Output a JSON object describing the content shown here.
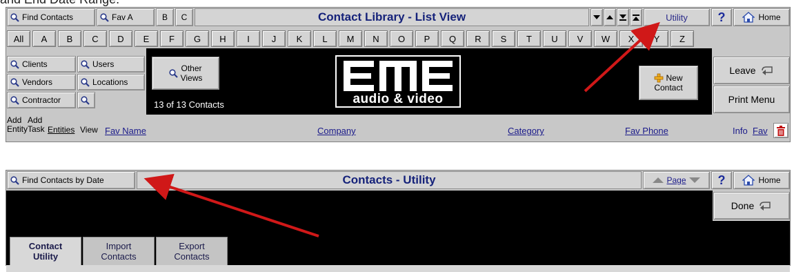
{
  "caption": "and End Date Range.",
  "list_view": {
    "title": "Contact Library - List View",
    "toolbar": {
      "find_contacts": "Find Contacts",
      "fav_a": "Fav A",
      "b": "B",
      "c": "C",
      "utility": "Utility",
      "help": "?",
      "home": "Home"
    },
    "letters": [
      "All",
      "A",
      "B",
      "C",
      "D",
      "E",
      "F",
      "G",
      "H",
      "I",
      "J",
      "K",
      "L",
      "M",
      "N",
      "O",
      "P",
      "Q",
      "R",
      "S",
      "T",
      "U",
      "V",
      "W",
      "X",
      "Y",
      "Z"
    ],
    "filters": {
      "clients": "Clients",
      "users": "Users",
      "vendors": "Vendors",
      "locations": "Locations",
      "contractor": "Contractor"
    },
    "other_views": "Other\nViews",
    "count_text": "13 of 13 Contacts",
    "logo_text": "audio & video",
    "new_contact": {
      "line1": "New",
      "line2": "Contact"
    },
    "leave": "Leave",
    "print_menu": "Print Menu",
    "columns": {
      "add_entity": {
        "line1": "Add",
        "line2": "Entity"
      },
      "add_task": {
        "line1": "Add",
        "line2": "Task"
      },
      "entities": "Entities",
      "view": "View",
      "fav_name": "Fav Name",
      "company": "Company",
      "category": "Category",
      "fav_phone": "Fav Phone",
      "info": "Info",
      "fav": "Fav"
    }
  },
  "utility": {
    "title": "Contacts - Utility",
    "find_by_date": "Find Contacts by Date",
    "page": "Page",
    "help": "?",
    "home": "Home",
    "done": "Done",
    "tabs": [
      {
        "line1": "Contact",
        "line2": "Utility"
      },
      {
        "line1": "Import",
        "line2": "Contacts"
      },
      {
        "line1": "Export",
        "line2": "Contacts"
      }
    ]
  },
  "colors": {
    "title_text": "#15227a",
    "panel_gray": "#c8c8c8",
    "button_gray": "#d4d4d4",
    "band_black": "#000000",
    "annotation_red": "#d01818"
  }
}
